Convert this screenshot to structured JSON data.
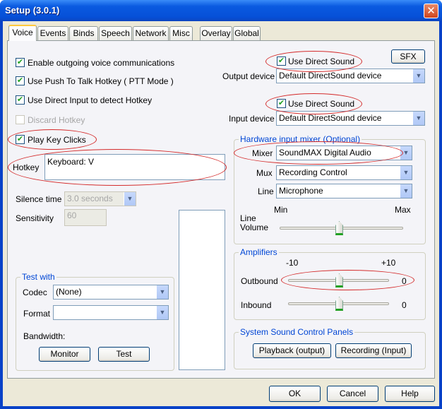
{
  "window": {
    "title": "Setup (3.0.1)",
    "close": "✕"
  },
  "tabs": [
    {
      "label": "Voice",
      "active": true
    },
    {
      "label": "Events"
    },
    {
      "label": "Binds"
    },
    {
      "label": "Speech"
    },
    {
      "label": "Network"
    },
    {
      "label": "Misc"
    },
    {
      "label": "Overlay"
    },
    {
      "label": "Global"
    }
  ],
  "voice": {
    "enable_outgoing": {
      "label": "Enable outgoing voice communications",
      "checked": true
    },
    "ptt": {
      "label": "Use Push To Talk Hotkey ( PTT Mode )",
      "checked": true
    },
    "direct_input": {
      "label": "Use Direct Input to detect Hotkey",
      "checked": true
    },
    "discard": {
      "label": "Discard Hotkey",
      "checked": false,
      "disabled": true
    },
    "key_clicks": {
      "label": "Play Key Clicks",
      "checked": true
    },
    "hotkey_label": "Hotkey",
    "hotkey_value": "Keyboard: V",
    "silence_label": "Silence time",
    "silence_value": "3.0 seconds",
    "sensitivity_label": "Sensitivity",
    "sensitivity_value": "60",
    "test_with": {
      "title": "Test with",
      "codec_label": "Codec",
      "codec_value": "(None)",
      "format_label": "Format",
      "format_value": "",
      "bandwidth_label": "Bandwidth:",
      "monitor": "Monitor",
      "test": "Test"
    },
    "sfx": "SFX",
    "output_direct_sound": {
      "label": "Use Direct Sound",
      "checked": true
    },
    "output_label": "Output device",
    "output_value": "Default DirectSound device",
    "input_direct_sound": {
      "label": "Use Direct Sound",
      "checked": true
    },
    "input_label": "Input device",
    "input_value": "Default DirectSound device",
    "mixer_group": {
      "title": "Hardware input mixer (Optional)",
      "mixer_label": "Mixer",
      "mixer_value": "SoundMAX Digital Audio",
      "mux_label": "Mux",
      "mux_value": "Recording Control",
      "line_label": "Line",
      "line_value": "Microphone",
      "min": "Min",
      "max": "Max",
      "line_volume_label": "Line Volume",
      "line_volume_level": 0.5
    },
    "amplifiers": {
      "title": "Amplifiers",
      "min": "-10",
      "max": "+10",
      "outbound_label": "Outbound",
      "outbound_value": "0",
      "inbound_label": "Inbound",
      "inbound_value": "0"
    },
    "sound_panels": {
      "title": "System Sound Control Panels",
      "playback": "Playback (output)",
      "recording": "Recording (Input)"
    }
  },
  "footer": {
    "ok": "OK",
    "cancel": "Cancel",
    "help": "Help"
  },
  "check_mark": "✔",
  "arrow": "▼",
  "annotation_color": "#D42B2B"
}
